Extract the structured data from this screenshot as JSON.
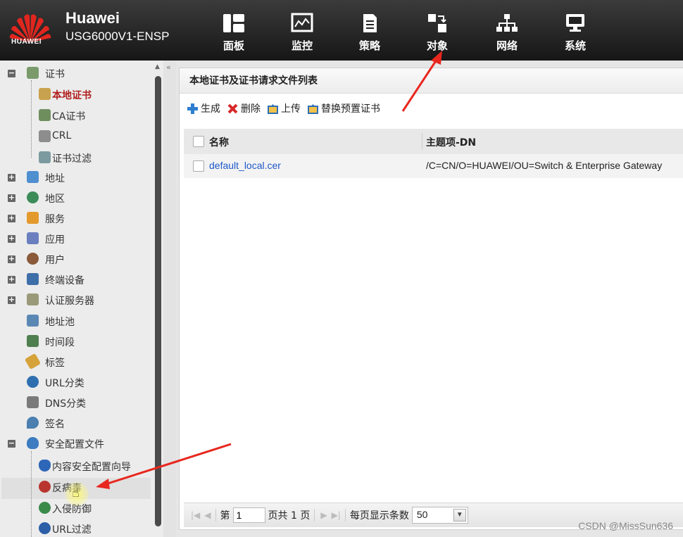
{
  "header": {
    "logo_text": "HUAWEI",
    "brand_name": "Huawei",
    "model": "USG6000V1-ENSP",
    "nav": [
      {
        "label": "面板",
        "icon": "dashboard-icon"
      },
      {
        "label": "监控",
        "icon": "monitor-icon"
      },
      {
        "label": "策略",
        "icon": "policy-icon"
      },
      {
        "label": "对象",
        "icon": "object-icon"
      },
      {
        "label": "网络",
        "icon": "network-icon"
      },
      {
        "label": "系统",
        "icon": "system-icon"
      }
    ]
  },
  "sidebar": {
    "items": [
      {
        "label": "证书",
        "toggle": "−"
      },
      {
        "label": "本地证书"
      },
      {
        "label": "CA证书"
      },
      {
        "label": "CRL"
      },
      {
        "label": "证书过滤"
      },
      {
        "label": "地址",
        "toggle": "+"
      },
      {
        "label": "地区",
        "toggle": "+"
      },
      {
        "label": "服务",
        "toggle": "+"
      },
      {
        "label": "应用",
        "toggle": "+"
      },
      {
        "label": "用户",
        "toggle": "+"
      },
      {
        "label": "终端设备",
        "toggle": "+"
      },
      {
        "label": "认证服务器",
        "toggle": "+"
      },
      {
        "label": "地址池"
      },
      {
        "label": "时间段"
      },
      {
        "label": "标签"
      },
      {
        "label": "URL分类"
      },
      {
        "label": "DNS分类"
      },
      {
        "label": "签名"
      },
      {
        "label": "安全配置文件",
        "toggle": "−"
      },
      {
        "label": "内容安全配置向导"
      },
      {
        "label": "反病毒"
      },
      {
        "label": "入侵防御"
      },
      {
        "label": "URL过滤"
      }
    ]
  },
  "main": {
    "title": "本地证书及证书请求文件列表",
    "toolbar": {
      "generate": "生成",
      "delete": "删除",
      "upload": "上传",
      "replace": "替换预置证书"
    },
    "table": {
      "columns": [
        "名称",
        "主题项-DN"
      ],
      "rows": [
        {
          "name": "default_local.cer",
          "dn": "/C=CN/O=HUAWEI/OU=Switch & Enterprise Gateway"
        }
      ]
    },
    "pager": {
      "page_prefix": "第",
      "page_value": "1",
      "page_total": "页共 1 页",
      "per_page_label": "每页显示条数",
      "per_page_value": "50"
    }
  },
  "watermark": "CSDN @MissSun636",
  "colors": {
    "header_bg": "#1f1f1f",
    "link": "#1f58c9",
    "active": "#b01e1e",
    "arrow": "#e8271e"
  }
}
